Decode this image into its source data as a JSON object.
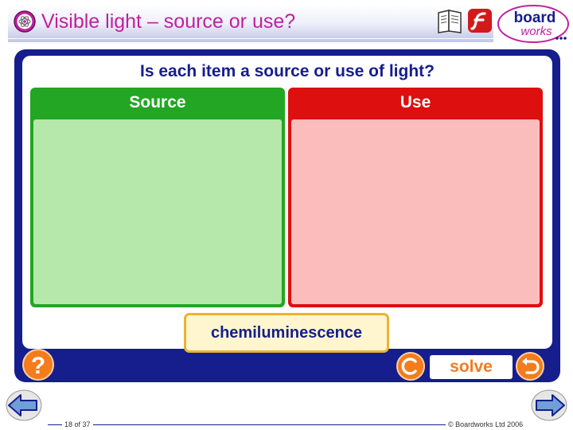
{
  "header": {
    "title": "Visible light – source or use?",
    "title_icon": "physics-topic-icon",
    "tools": [
      "notes-book-icon",
      "flash-icon"
    ],
    "logo": {
      "text_top": "board",
      "text_bottom": "works"
    }
  },
  "activity": {
    "question": "Is each item a source or use of light?",
    "columns": [
      {
        "label": "Source",
        "color": "#22a623"
      },
      {
        "label": "Use",
        "color": "#dd0f0f"
      }
    ],
    "current_item": "chemiluminescence",
    "controls": {
      "help_label": "?",
      "reset_label": "C",
      "solve_label": "solve"
    }
  },
  "footer": {
    "slide_count": "18 of 37",
    "copyright": "© Boardworks Ltd 2006"
  },
  "colors": {
    "title": "#c21fa0",
    "panel": "#151e8c",
    "accent": "#f47c1c"
  }
}
